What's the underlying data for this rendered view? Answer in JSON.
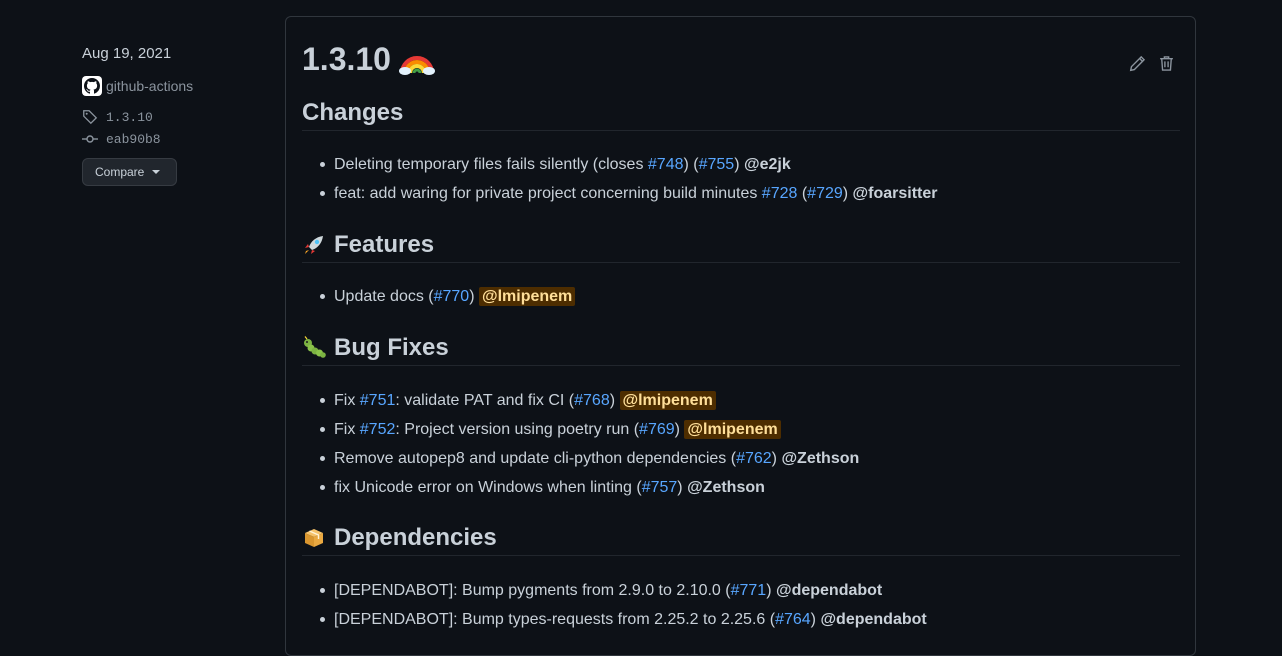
{
  "sidebar": {
    "date": "Aug 19, 2021",
    "author": "github-actions",
    "tag": "1.3.10",
    "commit": "eab90b8",
    "compare_label": "Compare"
  },
  "release": {
    "title": "1.3.10"
  },
  "sections": {
    "changes": {
      "title": "Changes",
      "items": [
        {
          "text": "Deleting temporary files fails silently (closes ",
          "link1": "#748",
          "mid": ") (",
          "link2": "#755",
          "end": ") ",
          "mention": "@e2jk"
        },
        {
          "text": "feat: add waring for private project concerning build minutes ",
          "link1": "#728",
          "mid": " (",
          "link2": "#729",
          "end": ") ",
          "mention": "@foarsitter"
        }
      ]
    },
    "features": {
      "title": "Features",
      "items": [
        {
          "text": "Update docs (",
          "link1": "#770",
          "end": ") ",
          "mention": "@lmipenem"
        }
      ]
    },
    "bugfixes": {
      "title": "Bug Fixes",
      "items": [
        {
          "pre": "Fix ",
          "link1": "#751",
          "text": ": validate PAT and fix CI (",
          "link2": "#768",
          "end": ") ",
          "mention": "@lmipenem"
        },
        {
          "pre": "Fix ",
          "link1": "#752",
          "text": ": Project version using poetry run (",
          "link2": "#769",
          "end": ") ",
          "mention": "@lmipenem"
        },
        {
          "text": "Remove autopep8 and update cli-python dependencies (",
          "link1": "#762",
          "end": ") ",
          "mention": "@Zethson"
        },
        {
          "text": "fix Unicode error on Windows when linting (",
          "link1": "#757",
          "end": ") ",
          "mention": "@Zethson"
        }
      ]
    },
    "dependencies": {
      "title": "Dependencies",
      "items": [
        {
          "text": "[DEPENDABOT]: Bump pygments from 2.9.0 to 2.10.0 (",
          "link1": "#771",
          "end": ") ",
          "mention": "@dependabot"
        },
        {
          "text": "[DEPENDABOT]: Bump types-requests from 2.25.2 to 2.25.6 (",
          "link1": "#764",
          "end": ") ",
          "mention": "@dependabot"
        }
      ]
    }
  },
  "colors": {
    "background": "#0d1117",
    "link": "#58a6ff",
    "mention_highlight_bg": "#4d2d00",
    "mention_highlight_fg": "#ffdf99"
  },
  "icons": {
    "author": "github-mark-icon",
    "tag": "tag-icon",
    "commit": "git-commit-icon",
    "edit": "pencil-icon",
    "delete": "trash-icon",
    "title": "rainbow-emoji",
    "features": "rocket-emoji",
    "bugfixes": "bug-emoji",
    "dependencies": "package-emoji"
  }
}
